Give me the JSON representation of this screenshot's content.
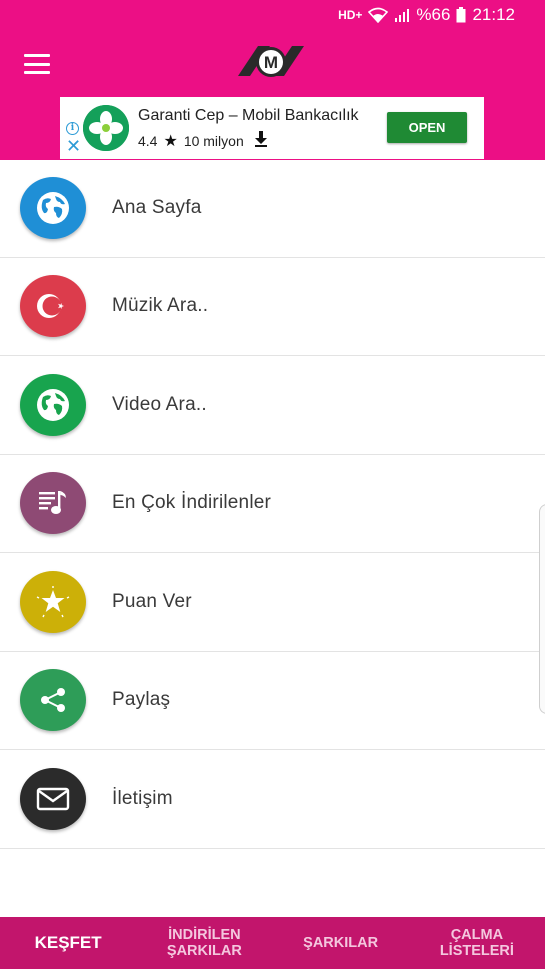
{
  "status_bar": {
    "network": "HD+",
    "battery": "%66",
    "time": "21:12"
  },
  "app_bar": {
    "menu_icon": "hamburger-menu-icon",
    "logo_letter": "M"
  },
  "ad": {
    "title": "Garanti Cep – Mobil Bankacılık",
    "rating": "4.4",
    "installs": "10 milyon",
    "open_label": "OPEN",
    "info_symbol": "i",
    "close_symbol": "✕"
  },
  "menu": {
    "items": [
      {
        "label": "Ana Sayfa",
        "icon": "globe-icon",
        "color": "#1f8fd6"
      },
      {
        "label": "Müzik Ara..",
        "icon": "turkish-flag-icon",
        "color": "#dc3c4c"
      },
      {
        "label": "Video Ara..",
        "icon": "globe-icon",
        "color": "#18a44e"
      },
      {
        "label": "En Çok İndirilenler",
        "icon": "music-list-icon",
        "color": "#8e4a74"
      },
      {
        "label": "Puan Ver",
        "icon": "star-icon",
        "color": "#ccb008"
      },
      {
        "label": "Paylaş",
        "icon": "share-icon",
        "color": "#2e9d58"
      },
      {
        "label": "İletişim",
        "icon": "mail-icon",
        "color": "#2b2b2b"
      }
    ]
  },
  "bottom_nav": {
    "tabs": [
      {
        "label": "KEŞFET",
        "active": true
      },
      {
        "label": "İNDİRİLEN ŞARKILAR",
        "active": false
      },
      {
        "label": "ŞARKILAR",
        "active": false
      },
      {
        "label": "ÇALMA LİSTELERİ",
        "active": false
      }
    ]
  },
  "colors": {
    "primary": "#ec0f85",
    "bottom_nav": "#c2156c",
    "ad_button": "#1f8a34"
  }
}
